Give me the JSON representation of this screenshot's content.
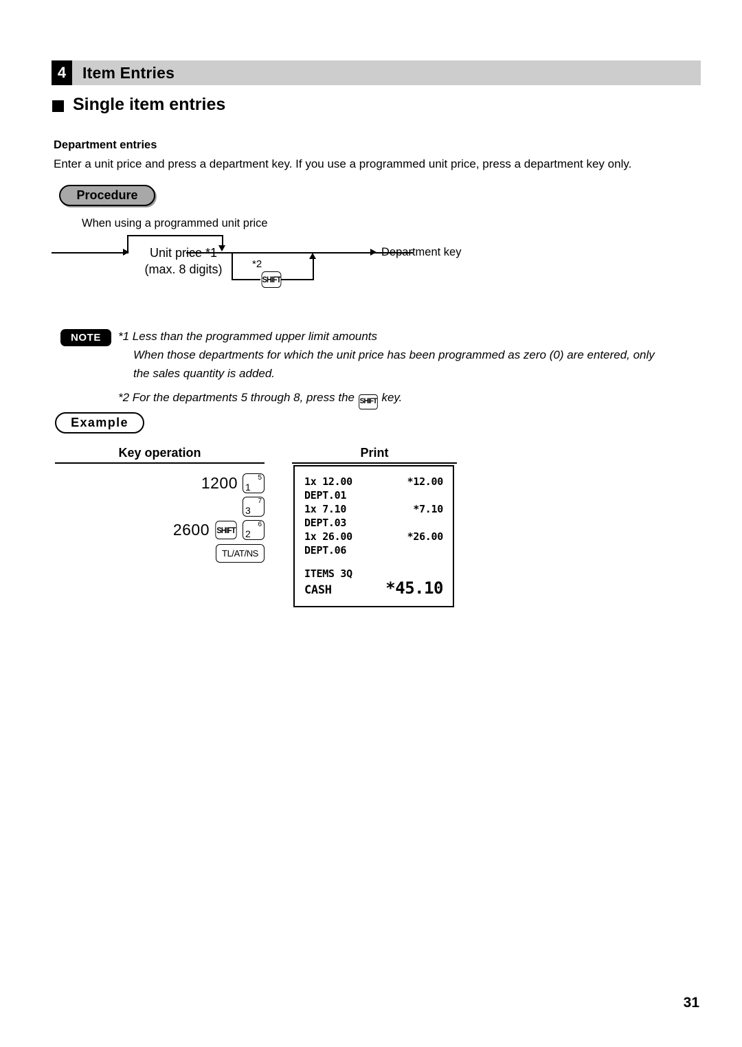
{
  "section": {
    "number": "4",
    "title": "Item Entries"
  },
  "subsection": {
    "title": "Single item entries"
  },
  "topic": {
    "heading": "Department entries",
    "paragraph": "Enter a unit price and press a department key. If you use a programmed unit price, press a department key only."
  },
  "procedure": {
    "badge": "Procedure",
    "diagram": {
      "bypass_label": "When using a programmed unit price",
      "node_line1": "Unit price *1",
      "node_line2": "(max. 8 digits)",
      "branch_marker": "*2",
      "shift_key": "SHIFT",
      "end_node": "Department key"
    }
  },
  "note": {
    "badge": "NOTE",
    "line1": "*1 Less than the programmed upper limit amounts",
    "line2": "When those departments for which the unit price has been programmed as zero (0) are entered, only",
    "line3": "the sales quantity is added.",
    "line4_pre": "*2 For the departments 5 through 8, press the",
    "line4_key": "SHIFT",
    "line4_post": "key."
  },
  "example": {
    "badge": "Example",
    "columns": {
      "key_operation": "Key operation",
      "print": "Print"
    },
    "key_operation_rows": [
      {
        "amount": "1200",
        "keys": [
          {
            "type": "dept",
            "big": "1",
            "small": "5"
          }
        ]
      },
      {
        "amount": "",
        "keys": [
          {
            "type": "dept",
            "big": "3",
            "small": "7"
          }
        ]
      },
      {
        "amount": "2600",
        "keys": [
          {
            "type": "shift",
            "label": "SHIFT"
          },
          {
            "type": "dept",
            "big": "2",
            "small": "6"
          }
        ]
      },
      {
        "amount": "",
        "keys": [
          {
            "type": "total",
            "label": "TL/AT/NS"
          }
        ]
      }
    ],
    "receipt": {
      "lines": [
        {
          "left": "1x 12.00",
          "right": "*12.00"
        },
        {
          "left": "DEPT.01",
          "right": ""
        },
        {
          "left": "1x 7.10",
          "right": "*7.10"
        },
        {
          "left": "DEPT.03",
          "right": ""
        },
        {
          "left": "1x 26.00",
          "right": "*26.00"
        },
        {
          "left": "DEPT.06",
          "right": ""
        }
      ],
      "items_line": "ITEMS 3Q",
      "total_label": "CASH",
      "total_amount": "*45.10"
    }
  },
  "footer": {
    "page_number": "31"
  },
  "colors": {
    "header_bar": "#cdcdcd",
    "procedure_pill": "#a8a8a8",
    "ink": "#000000",
    "paper": "#ffffff"
  }
}
